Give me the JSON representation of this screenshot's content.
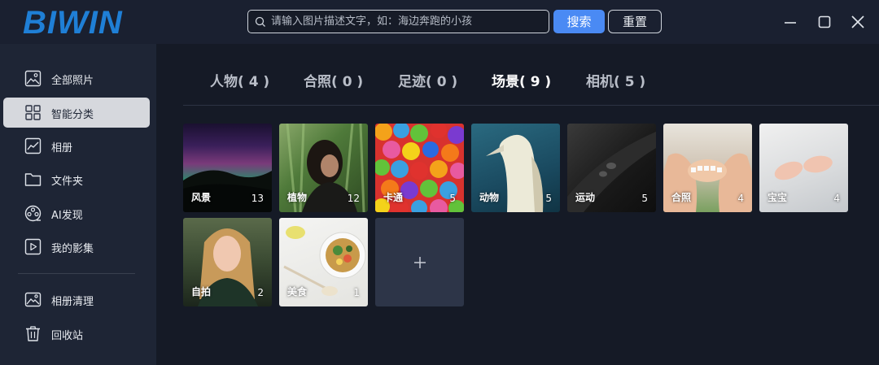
{
  "app": {
    "logo_text": "BIWIN"
  },
  "search": {
    "placeholder": "请输入图片描述文字，如：海边奔跑的小孩",
    "value": ""
  },
  "toolbar": {
    "search_label": "搜索",
    "reset_label": "重置"
  },
  "sidebar": {
    "items": [
      {
        "label": "全部照片",
        "icon": "photo-icon"
      },
      {
        "label": "智能分类",
        "icon": "grid-icon",
        "active": true
      },
      {
        "label": "相册",
        "icon": "album-chart-icon"
      },
      {
        "label": "文件夹",
        "icon": "folder-icon"
      },
      {
        "label": "AI发现",
        "icon": "film-reel-icon"
      },
      {
        "label": "我的影集",
        "icon": "play-icon"
      },
      {
        "label": "相册清理",
        "icon": "image-clean-icon"
      },
      {
        "label": "回收站",
        "icon": "trash-icon"
      }
    ]
  },
  "tabs": [
    {
      "label": "人物( 4 )"
    },
    {
      "label": "合照( 0 )"
    },
    {
      "label": "足迹( 0 )"
    },
    {
      "label": "场景( 9 )",
      "active": true
    },
    {
      "label": "相机( 5 )"
    }
  ],
  "categories": [
    {
      "name": "风景",
      "count": "13"
    },
    {
      "name": "植物",
      "count": "12"
    },
    {
      "name": "卡通",
      "count": "5"
    },
    {
      "name": "动物",
      "count": "5"
    },
    {
      "name": "运动",
      "count": "5"
    },
    {
      "name": "合照",
      "count": "4"
    },
    {
      "name": "宝宝",
      "count": "4"
    },
    {
      "name": "自拍",
      "count": "2"
    },
    {
      "name": "美食",
      "count": "1"
    }
  ],
  "add_tile": {
    "icon": "plus-icon"
  },
  "colors": {
    "accent": "#4a8af4",
    "logo": "#1f7fd6",
    "background": "#151a26",
    "sidebar": "#1e2535"
  }
}
